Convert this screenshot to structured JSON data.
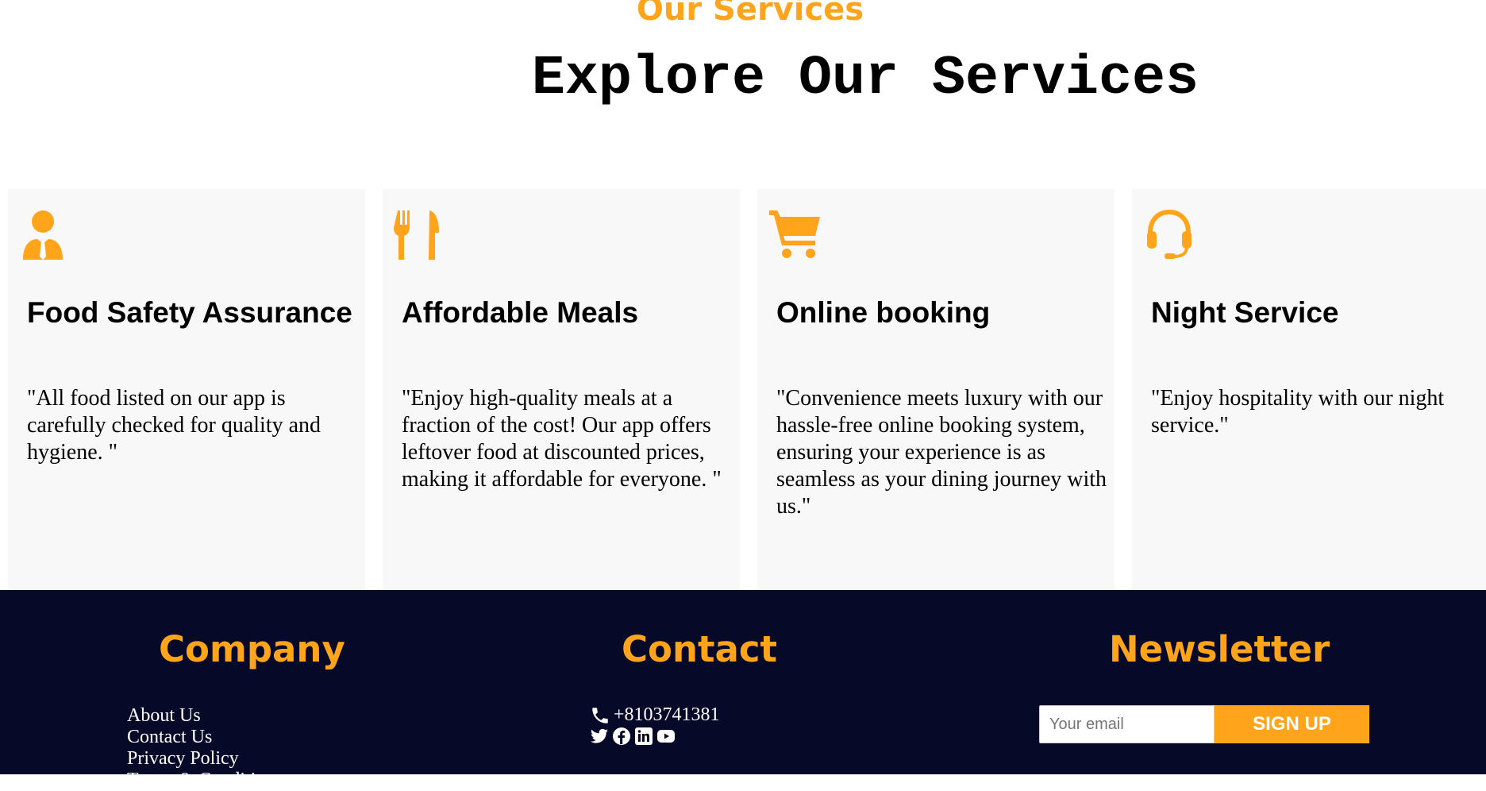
{
  "services": {
    "kicker": "Our Services",
    "title": "Explore Our Services",
    "cards": [
      {
        "icon": "user-tie-icon",
        "title": "Food Safety Assurance",
        "text": "\"All food listed on our app is carefully checked for quality and hygiene. \""
      },
      {
        "icon": "utensils-icon",
        "title": "Affordable Meals",
        "text": "\"Enjoy high-quality meals at a fraction of the cost! Our app offers leftover food at discounted prices, making it affordable for everyone. \""
      },
      {
        "icon": "cart-icon",
        "title": "Online booking",
        "text": "\"Convenience meets luxury with our hassle-free online booking system, ensuring your experience is as seamless as your dining journey with us.\""
      },
      {
        "icon": "headset-icon",
        "title": "Night Service",
        "text": "\"Enjoy hospitality with our night service.\""
      }
    ]
  },
  "footer": {
    "company": {
      "heading": "Company",
      "links": [
        "About Us",
        "Contact Us",
        "Privacy Policy",
        "Terms & Condition"
      ]
    },
    "contact": {
      "heading": "Contact",
      "phone": "+8103741381",
      "socials": [
        "twitter-icon",
        "facebook-icon",
        "linkedin-icon",
        "youtube-icon"
      ]
    },
    "newsletter": {
      "heading": "Newsletter",
      "placeholder": "Your email",
      "button": "SIGN UP"
    }
  },
  "colors": {
    "accent": "#ffa41b",
    "footer_bg": "#060a28",
    "card_bg": "#f8f8f8"
  }
}
